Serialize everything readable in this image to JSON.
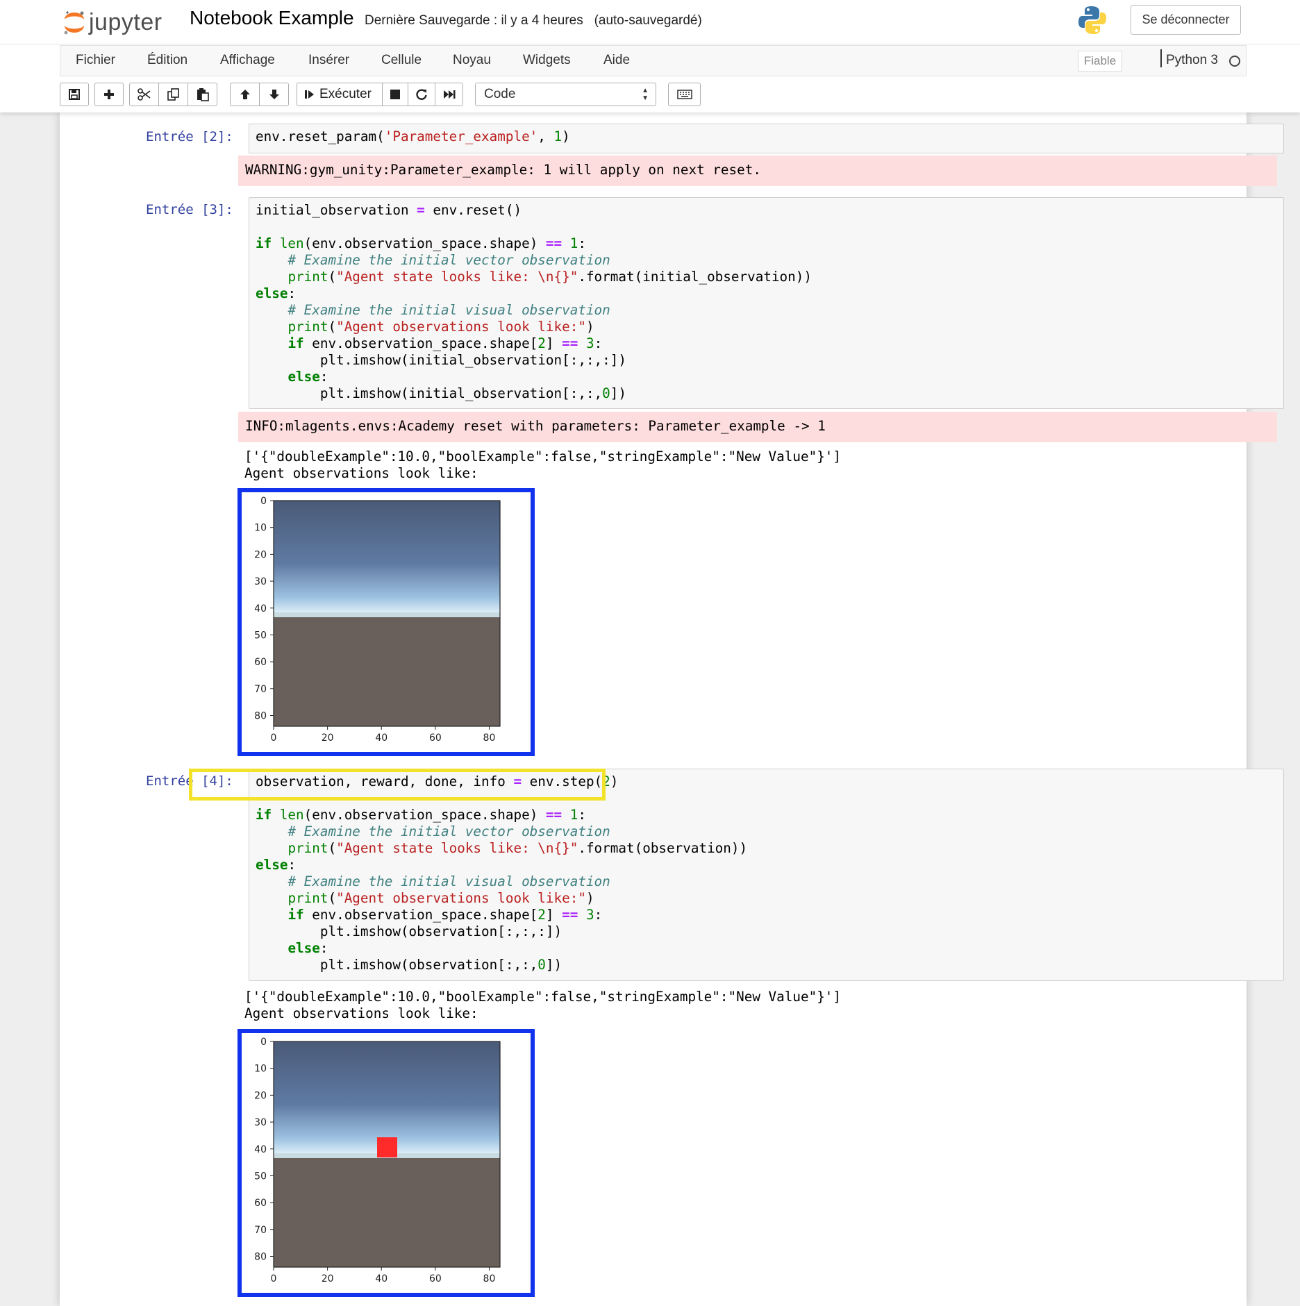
{
  "header": {
    "logo_text": "jupyter",
    "notebook_title": "Notebook Example",
    "save_status": "Dernière Sauvegarde : il y a 4 heures   (auto-sauvegardé)",
    "logout_label": "Se déconnecter"
  },
  "menubar": {
    "items": [
      "Fichier",
      "Édition",
      "Affichage",
      "Insérer",
      "Cellule",
      "Noyau",
      "Widgets",
      "Aide"
    ],
    "trusted_label": "Fiable",
    "kernel_name": "Python 3"
  },
  "toolbar": {
    "run_label": "Exécuter",
    "cell_type": "Code",
    "icons": [
      "save-icon",
      "plus-icon",
      "cut-icon",
      "copy-icon",
      "paste-icon",
      "arrow-up-icon",
      "arrow-down-icon",
      "run-icon",
      "stop-icon",
      "restart-icon",
      "fast-forward-icon",
      "keyboard-icon"
    ]
  },
  "cells": [
    {
      "prompt": "Entrée [2]:",
      "stderr": "WARNING:gym_unity:Parameter_example: 1 will apply on next reset."
    },
    {
      "prompt": "Entrée [3]:",
      "stderr": "INFO:mlagents.envs:Academy reset with parameters: Parameter_example -> 1",
      "stdout": "['{\"doubleExample\":10.0,\"boolExample\":false,\"stringExample\":\"New Value\"}']\nAgent observations look like:"
    },
    {
      "prompt": "Entrée [4]:",
      "stdout": "['{\"doubleExample\":10.0,\"boolExample\":false,\"stringExample\":\"New Value\"}']\nAgent observations look like:"
    }
  ],
  "plot": {
    "x_ticks": [
      "0",
      "20",
      "40",
      "60",
      "80"
    ],
    "y_ticks": [
      "0",
      "10",
      "20",
      "30",
      "40",
      "50",
      "60",
      "70",
      "80"
    ],
    "colors": {
      "sky_top": "#4a5a78",
      "sky_mid": "#6d89b0",
      "horizon": "#e8f6fb",
      "ground": "#6a605b",
      "agent": "#ff2a2a",
      "highlight_blue": "#1133ee",
      "highlight_yellow": "#f2e32a"
    }
  }
}
